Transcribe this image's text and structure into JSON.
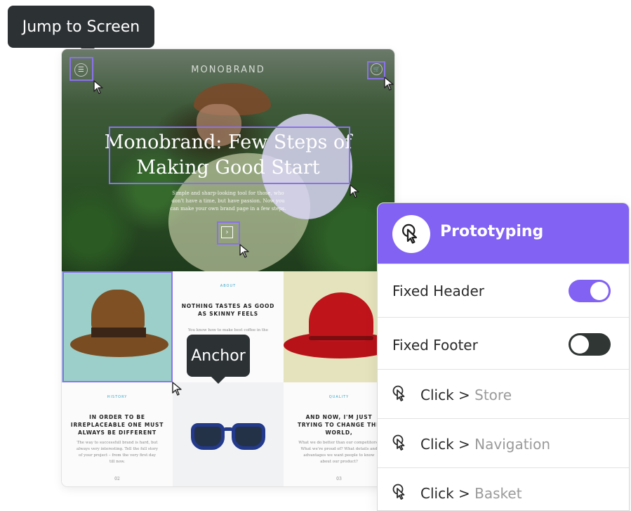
{
  "tooltip_top": "Jump to Screen",
  "tooltip_anchor": "Anchor",
  "site": {
    "brand": "MONOBRAND",
    "hero_title": "Monobrand: Few Steps of Making Good Start",
    "hero_subtitle": "Simple and sharp-looking tool for those, who don't have a time, but have passion. Now you can make your own brand page in a few steps.",
    "menu_icon": "☰",
    "cart_icon": "🛒",
    "next_icon": "›",
    "about": {
      "eyebrow": "ABOUT",
      "heading": "NOTHING TASTES AS GOOD AS SKINNY FEELS",
      "body": "You know how to make best coffee in the"
    },
    "history": {
      "eyebrow": "HISTORY",
      "heading": "IN ORDER TO BE IRREPLACEABLE ONE MUST ALWAYS BE DIFFERENT",
      "body": "The way to successfull brand is hard, but always very interesting. Tell the full story of your project – from the very first day till now.",
      "number": "02"
    },
    "quality": {
      "eyebrow": "QUALITY",
      "heading": "AND NOW, I'M JUST TRYING TO CHANGE THE WORLD,",
      "body": "What we do better than our competitors? What we're proud of? What details and advantages we want people to know about our product?",
      "number": "03"
    }
  },
  "panel": {
    "title": "Prototyping",
    "fixed_header": {
      "label": "Fixed Header",
      "enabled": true
    },
    "fixed_footer": {
      "label": "Fixed Footer",
      "enabled": false
    },
    "actions": [
      {
        "trigger": "Click",
        "separator": ">",
        "target": "Store",
        "icon": "pointer-click-icon"
      },
      {
        "trigger": "Click",
        "separator": ">",
        "target": "Navigation",
        "icon": "pointer-click-icon"
      },
      {
        "trigger": "Click",
        "separator": ">",
        "target": "Basket",
        "icon": "pointer-click-icon"
      }
    ]
  },
  "colors": {
    "accent": "#8262f3",
    "tooltip_bg": "#2c3134",
    "selection": "#8a72ea",
    "toggle_off": "#2f3634"
  }
}
